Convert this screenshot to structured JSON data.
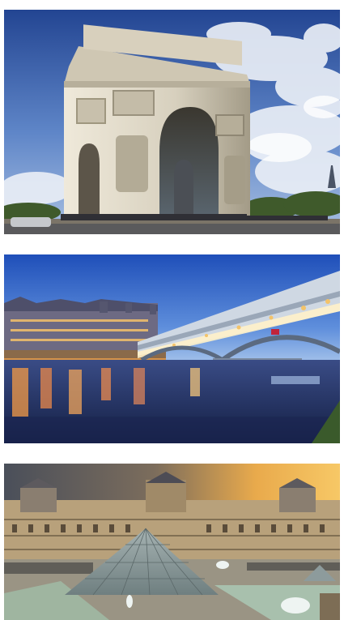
{
  "gallery": {
    "photos": [
      {
        "subject": "arc-de-triomphe",
        "colors": {
          "sky_top": "#2b4e9e",
          "sky_bottom": "#7fa3d6",
          "stone": "#d9d3c3",
          "shadow": "#9c9584"
        }
      },
      {
        "subject": "bir-hakeim-bridge-dusk",
        "colors": {
          "sky_top": "#2c59c4",
          "sky_bottom": "#8db3e6",
          "water": "#1c2f66",
          "lights": "#ffb347"
        }
      },
      {
        "subject": "louvre-pyramid-sunset",
        "colors": {
          "sky_left": "#4a4f5c",
          "sky_right": "#f2b24a",
          "building": "#b9a27c",
          "glass": "#8fa1a3"
        }
      }
    ]
  }
}
